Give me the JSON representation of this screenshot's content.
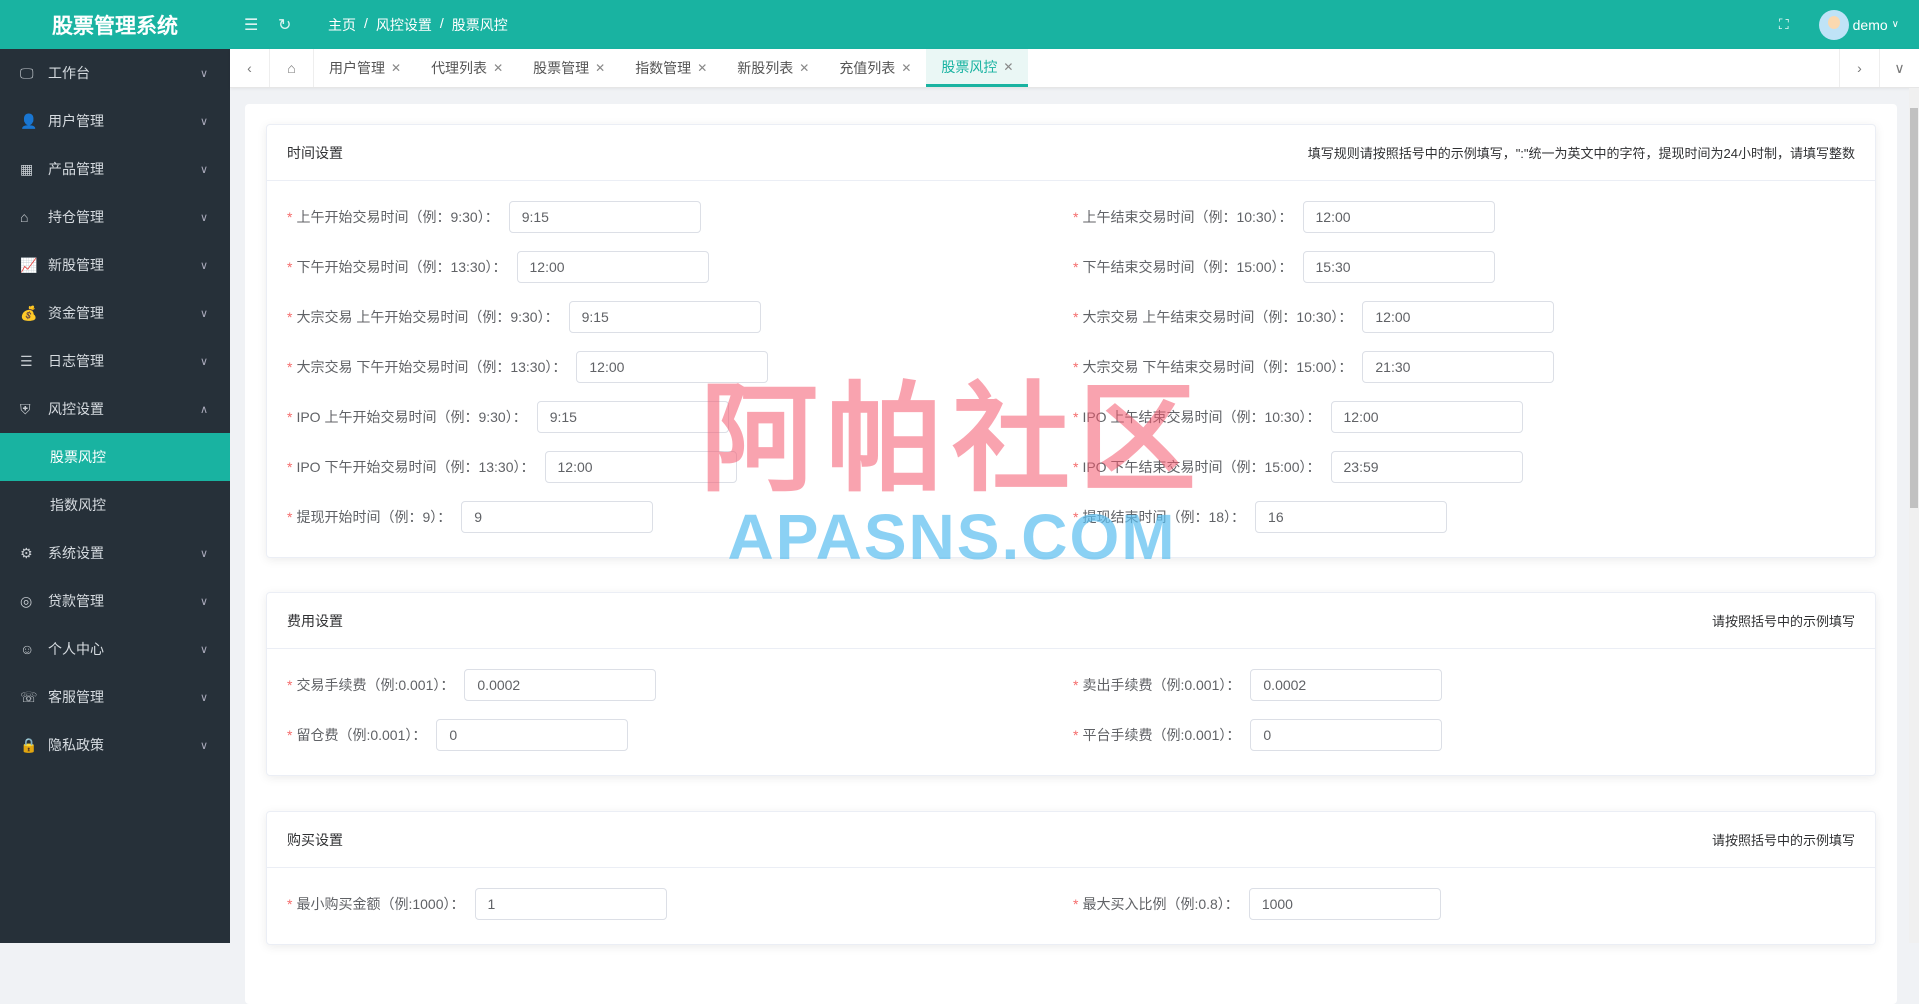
{
  "header": {
    "title": "股票管理系统",
    "breadcrumb": [
      "主页",
      "风控设置",
      "股票风控"
    ],
    "sep": "/",
    "user": "demo"
  },
  "sidebar": {
    "items": [
      {
        "label": "工作台",
        "icon": "monitor-icon",
        "glyph": "🖵"
      },
      {
        "label": "用户管理",
        "icon": "user-icon",
        "glyph": "👤"
      },
      {
        "label": "产品管理",
        "icon": "grid-icon",
        "glyph": "▦"
      },
      {
        "label": "持仓管理",
        "icon": "home-icon",
        "glyph": "⌂"
      },
      {
        "label": "新股管理",
        "icon": "chart-icon",
        "glyph": "📈"
      },
      {
        "label": "资金管理",
        "icon": "money-icon",
        "glyph": "💰"
      },
      {
        "label": "日志管理",
        "icon": "log-icon",
        "glyph": "☰"
      },
      {
        "label": "风控设置",
        "icon": "shield-icon",
        "glyph": "⛨"
      },
      {
        "label": "系统设置",
        "icon": "settings-icon",
        "glyph": "⚙"
      },
      {
        "label": "贷款管理",
        "icon": "loan-icon",
        "glyph": "◎"
      },
      {
        "label": "个人中心",
        "icon": "person-icon",
        "glyph": "☺"
      },
      {
        "label": "客服管理",
        "icon": "service-icon",
        "glyph": "☏"
      },
      {
        "label": "隐私政策",
        "icon": "privacy-icon",
        "glyph": "🔒"
      }
    ],
    "sub": [
      "股票风控",
      "指数风控"
    ]
  },
  "tabs": [
    "用户管理",
    "代理列表",
    "股票管理",
    "指数管理",
    "新股列表",
    "充值列表",
    "股票风控"
  ],
  "cards": [
    {
      "title": "时间设置",
      "hint": "填写规则请按照括号中的示例填写，\":\"统一为英文中的字符，提现时间为24小时制，请填写整数",
      "rows": [
        [
          {
            "label": "上午开始交易时间（例：9:30）：",
            "value": "9:15"
          },
          {
            "label": "上午结束交易时间（例：10:30）：",
            "value": "12:00"
          }
        ],
        [
          {
            "label": "下午开始交易时间（例：13:30）：",
            "value": "12:00"
          },
          {
            "label": "下午结束交易时间（例：15:00）：",
            "value": "15:30"
          }
        ],
        [
          {
            "label": "大宗交易 上午开始交易时间（例：9:30）：",
            "value": "9:15"
          },
          {
            "label": "大宗交易 上午结束交易时间（例：10:30）：",
            "value": "12:00"
          }
        ],
        [
          {
            "label": "大宗交易 下午开始交易时间（例：13:30）：",
            "value": "12:00"
          },
          {
            "label": "大宗交易 下午结束交易时间（例：15:00）：",
            "value": "21:30"
          }
        ],
        [
          {
            "label": "IPO 上午开始交易时间（例：9:30）：",
            "value": "9:15"
          },
          {
            "label": "IPO 上午结束交易时间（例：10:30）：",
            "value": "12:00"
          }
        ],
        [
          {
            "label": "IPO 下午开始交易时间（例：13:30）：",
            "value": "12:00"
          },
          {
            "label": "IPO 下午结束交易时间（例：15:00）：",
            "value": "23:59"
          }
        ],
        [
          {
            "label": "提现开始时间（例：9）：",
            "value": "9"
          },
          {
            "label": "提现结束时间（例：18）：",
            "value": "16"
          }
        ]
      ]
    },
    {
      "title": "费用设置",
      "hint": "请按照括号中的示例填写",
      "rows": [
        [
          {
            "label": "交易手续费（例:0.001）：",
            "value": "0.0002"
          },
          {
            "label": "卖出手续费（例:0.001）：",
            "value": "0.0002"
          }
        ],
        [
          {
            "label": "留仓费（例:0.001）：",
            "value": "0"
          },
          {
            "label": "平台手续费（例:0.001）：",
            "value": "0"
          }
        ]
      ]
    },
    {
      "title": "购买设置",
      "hint": "请按照括号中的示例填写",
      "rows": [
        [
          {
            "label": "最小购买金额（例:1000）：",
            "value": "1"
          },
          {
            "label": "最大买入比例（例:0.8）：",
            "value": "1000"
          }
        ]
      ]
    }
  ],
  "watermark": {
    "line1": "阿帕社区",
    "line2": "APASNS.COM"
  }
}
